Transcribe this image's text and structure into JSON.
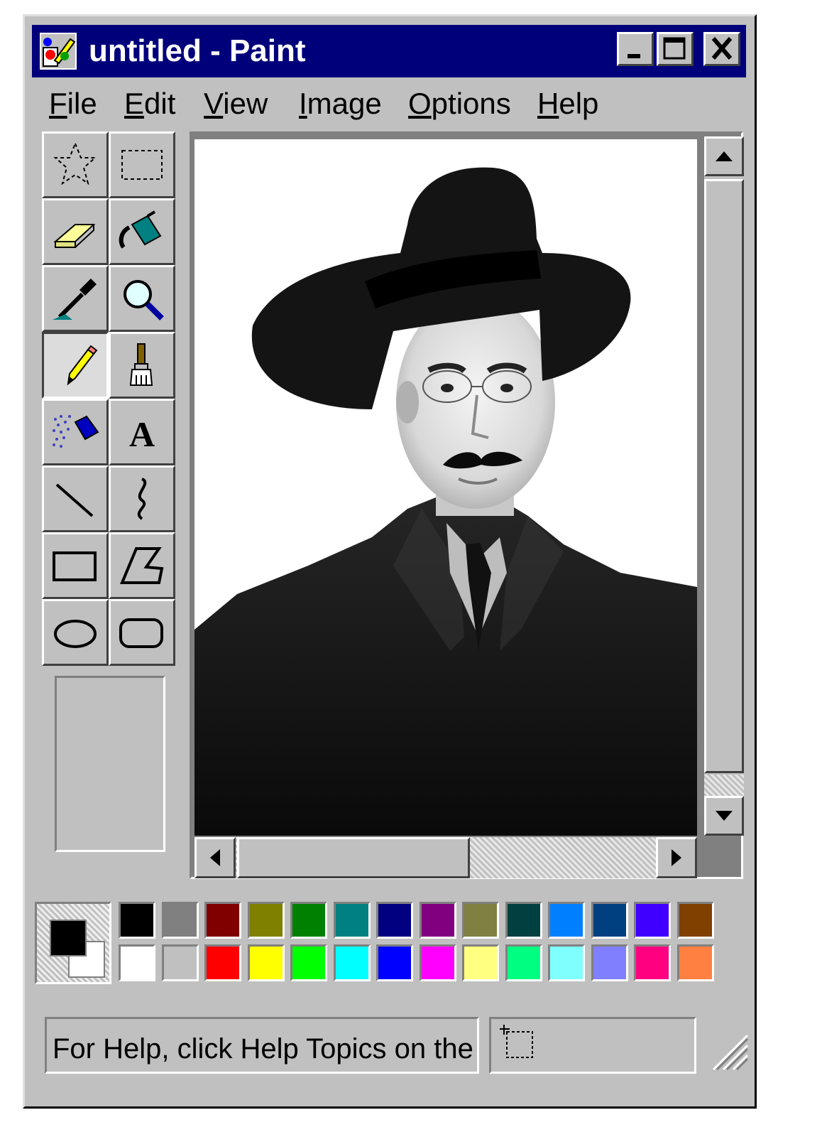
{
  "window": {
    "title": "untitled - Paint",
    "controls": [
      "minimize",
      "maximize",
      "close"
    ]
  },
  "menu": [
    {
      "label": "File",
      "accel": "F",
      "rest": "ile"
    },
    {
      "label": "Edit",
      "accel": "E",
      "rest": "dit"
    },
    {
      "label": "View",
      "accel": "V",
      "rest": "iew"
    },
    {
      "label": "Image",
      "accel": "I",
      "rest": "mage"
    },
    {
      "label": "Options",
      "accel": "O",
      "rest": "ptions"
    },
    {
      "label": "Help",
      "accel": "H",
      "rest": "elp"
    }
  ],
  "tools": [
    "free-form-select",
    "select",
    "eraser",
    "fill-with-color",
    "pick-color",
    "magnifier",
    "pencil",
    "brush",
    "airbrush",
    "text",
    "line",
    "curve",
    "rectangle",
    "polygon",
    "ellipse",
    "rounded-rectangle"
  ],
  "active_tool": "pencil",
  "canvas": {
    "image": "black-and-white portrait photograph of a man in a hat and dark coat"
  },
  "palette": {
    "foreground": "#000000",
    "background": "#ffffff",
    "colors_row1": [
      "#000000",
      "#808080",
      "#800000",
      "#808000",
      "#008000",
      "#008080",
      "#000080",
      "#800080",
      "#808040",
      "#004040",
      "#0080ff",
      "#004080",
      "#4000ff",
      "#804000"
    ],
    "colors_row2": [
      "#ffffff",
      "#c0c0c0",
      "#ff0000",
      "#ffff00",
      "#00ff00",
      "#00ffff",
      "#0000ff",
      "#ff00ff",
      "#ffff80",
      "#00ff80",
      "#80ffff",
      "#8080ff",
      "#ff0080",
      "#ff8040"
    ]
  },
  "status": {
    "text": "For Help, click Help Topics on the"
  }
}
